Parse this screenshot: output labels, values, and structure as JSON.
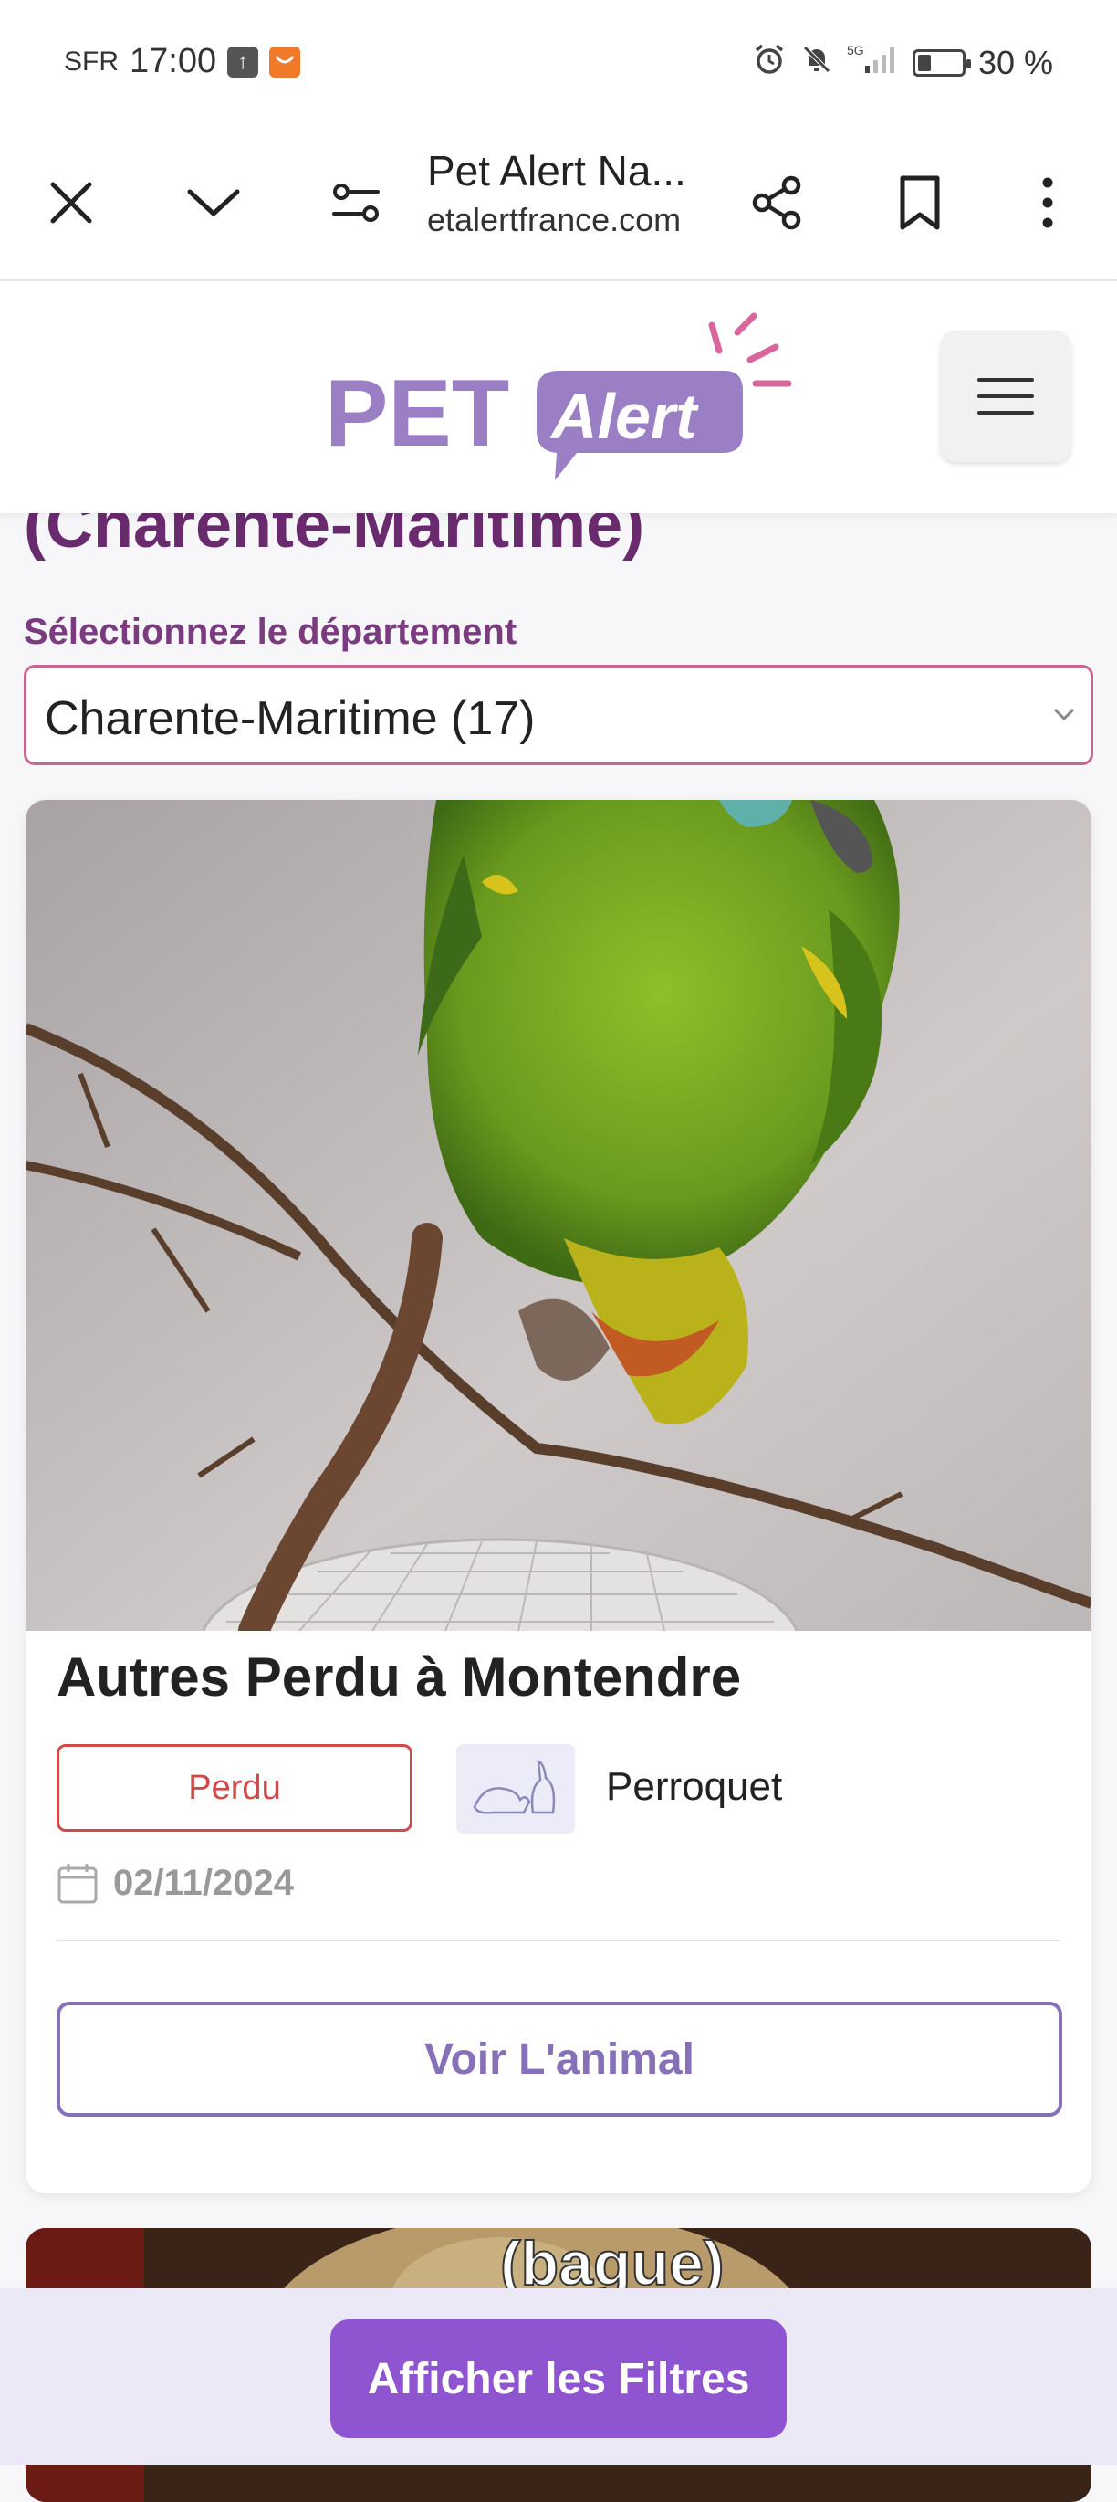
{
  "status_bar": {
    "carrier": "SFR",
    "time": "17:00",
    "network": "5G",
    "battery_text": "30 %",
    "battery_level": 0.3
  },
  "browser": {
    "page_title": "Pet Alert Na...",
    "url": "etalertfrance.com"
  },
  "header": {
    "logo_word1": "PET",
    "logo_word2": "Alert"
  },
  "page": {
    "heading": "(Charente-Maritime)",
    "select_label": "Sélectionnez le département",
    "select_value": "Charente-Maritime (17)"
  },
  "card": {
    "title": "Autres Perdu à Montendre",
    "status": "Perdu",
    "species": "Perroquet",
    "date": "02/11/2024",
    "button": "Voir L'animal"
  },
  "card2": {
    "overlay_text": "(bague)"
  },
  "bottom": {
    "filters_button": "Afficher les Filtres"
  },
  "colors": {
    "heading": "#6a2a6e",
    "accent_purple": "#8f55d1",
    "lost_red": "#d04a4a",
    "logo_pink": "#d9679c"
  }
}
